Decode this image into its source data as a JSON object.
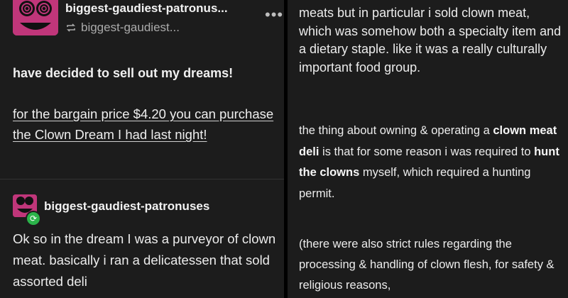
{
  "post": {
    "blog_name": "biggest-gaudiest-patronus...",
    "reblog_from": "biggest-gaudiest...",
    "more_label": "•••",
    "bold_line": "have decided to sell out my dreams!",
    "link_text": "for the bargain price $4.20 you can purchase the Clown Dream I had last night!",
    "reply_blog_name": "biggest-gaudiest-patronuses",
    "body_left": "Ok so in the dream I was a purveyor of clown meat. basically i ran a delicatessen that sold assorted deli",
    "body_right_1": "meats but in particular i sold clown meat, which was somehow both a specialty item and a dietary staple. like it was a really culturally important food group.",
    "body_right_2": {
      "t1": "the thing about owning & operating a ",
      "b1": "clown meat deli",
      "t2": " is that for some reason i was required to ",
      "b2": "hunt the clowns",
      "t3": " myself, which required a hunting permit."
    },
    "body_right_3": "(there were also strict rules regarding the processing & handling of clown flesh, for safety & religious reasons,"
  },
  "colors": {
    "background": "#1c1c1c",
    "avatar": "#c0367a",
    "reblog_badge": "#2bb34a"
  },
  "icons": {
    "reblog": "reblog-icon",
    "more": "more-icon"
  }
}
